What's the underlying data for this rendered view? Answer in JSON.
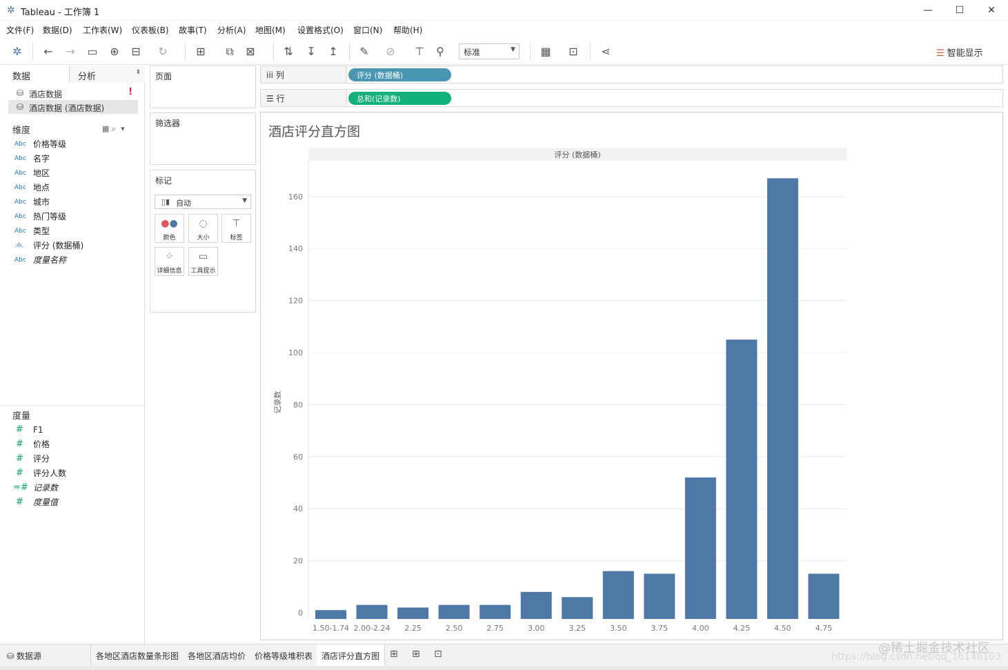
{
  "window": {
    "title": "Tableau - 工作簿 1",
    "app_icon": "tableau-logo-icon",
    "minimize": "—",
    "maximize": "☐",
    "close": "✕"
  },
  "menu": [
    "文件(F)",
    "数据(D)",
    "工作表(W)",
    "仪表板(B)",
    "故事(T)",
    "分析(A)",
    "地图(M)",
    "设置格式(O)",
    "窗口(N)",
    "帮助(H)"
  ],
  "toolbar": {
    "fit_select": "标准",
    "smart_show": "智能显示"
  },
  "left": {
    "tab_data": "数据",
    "tab_analysis": "分析",
    "datasources": [
      "酒店数据",
      "酒店数据 (酒店数据)"
    ],
    "warn": "!",
    "dimensions_title": "维度",
    "dimensions": [
      {
        "type": "Abc",
        "name": "价格等级",
        "italic": false
      },
      {
        "type": "Abc",
        "name": "名字",
        "italic": false
      },
      {
        "type": "Abc",
        "name": "地区",
        "italic": false
      },
      {
        "type": "Abc",
        "name": "地点",
        "italic": false
      },
      {
        "type": "Abc",
        "name": "城市",
        "italic": false
      },
      {
        "type": "Abc",
        "name": "热门等级",
        "italic": false
      },
      {
        "type": "Abc",
        "name": "类型",
        "italic": false
      },
      {
        "type": ".ılı.",
        "name": "评分 (数据桶)",
        "italic": false
      },
      {
        "type": "Abc",
        "name": "度量名称",
        "italic": true
      }
    ],
    "measures_title": "度量",
    "measures": [
      {
        "type": "#",
        "name": "F1",
        "italic": false
      },
      {
        "type": "#",
        "name": "价格",
        "italic": false
      },
      {
        "type": "#",
        "name": "评分",
        "italic": false
      },
      {
        "type": "#",
        "name": "评分人数",
        "italic": false
      },
      {
        "type": "=#",
        "name": "记录数",
        "italic": true
      },
      {
        "type": "#",
        "name": "度量值",
        "italic": true
      }
    ]
  },
  "cards": {
    "pages": "页面",
    "filters": "筛选器",
    "marks": "标记",
    "marks_type": "自动",
    "mark_buttons": [
      "颜色",
      "大小",
      "标签",
      "详细信息",
      "工具提示"
    ]
  },
  "shelves": {
    "columns_label": "列",
    "columns_icon": "iii",
    "columns_pill": "评分 (数据桶)",
    "rows_label": "行",
    "rows_icon": "☰",
    "rows_pill": "总和(记录数)"
  },
  "viz": {
    "title": "酒店评分直方图"
  },
  "chart_data": {
    "type": "bar",
    "title": "酒店评分直方图",
    "column_header": "评分 (数据桶)",
    "ylabel": "记录数",
    "xlabel": "",
    "categories": [
      "1.50-1.74",
      "2.00-2.24",
      "2.25",
      "2.50",
      "2.75",
      "3.00",
      "3.25",
      "3.50",
      "3.75",
      "4.00",
      "4.25",
      "4.50",
      "4.75"
    ],
    "values": [
      1,
      3,
      2,
      3,
      3,
      8,
      6,
      16,
      15,
      52,
      105,
      167,
      15
    ],
    "yticks": [
      0,
      20,
      40,
      60,
      80,
      100,
      120,
      140,
      160
    ],
    "ylim": [
      0,
      172
    ],
    "bar_color": "#4e79a7",
    "grid": true
  },
  "bottom": {
    "datasource_tab": "数据源",
    "sheets": [
      "各地区酒店数量条形图",
      "各地区酒店均价",
      "价格等级堆积表",
      "酒店评分直方图"
    ],
    "active_sheet": 3
  },
  "watermark": "@稀土掘金技术社区",
  "watermark_url": "https://blog.csdn.net/qq_16146103"
}
